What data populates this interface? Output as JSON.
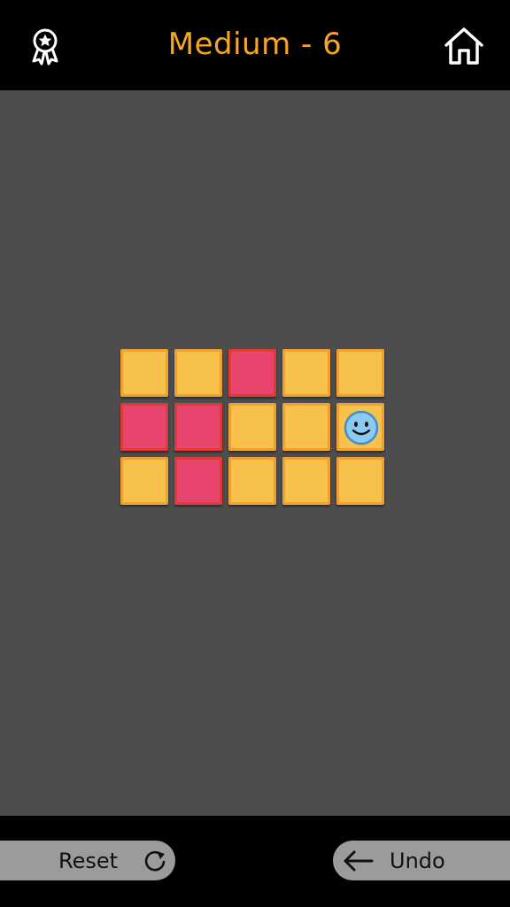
{
  "header": {
    "title": "Medium - 6",
    "award_icon": "award-ribbon-icon",
    "home_icon": "home-icon"
  },
  "board": {
    "rows": 3,
    "cols": 5,
    "tiles": [
      [
        "yellow",
        "yellow",
        "red",
        "yellow",
        "yellow"
      ],
      [
        "red",
        "red",
        "yellow",
        "yellow",
        "yellow"
      ],
      [
        "yellow",
        "red",
        "yellow",
        "yellow",
        "yellow"
      ]
    ],
    "player": {
      "row": 1,
      "col": 4,
      "icon": "smiley-face-icon"
    }
  },
  "footer": {
    "reset_label": "Reset",
    "reset_icon": "refresh-icon",
    "undo_label": "Undo",
    "undo_icon": "arrow-left-icon"
  },
  "colors": {
    "accent": "#f5a623",
    "board_background": "#4d4d4d",
    "tile_yellow": "#f7c14a",
    "tile_red": "#e8466e",
    "player_face": "#8ccbf0",
    "button_background": "#9b9b9b"
  }
}
